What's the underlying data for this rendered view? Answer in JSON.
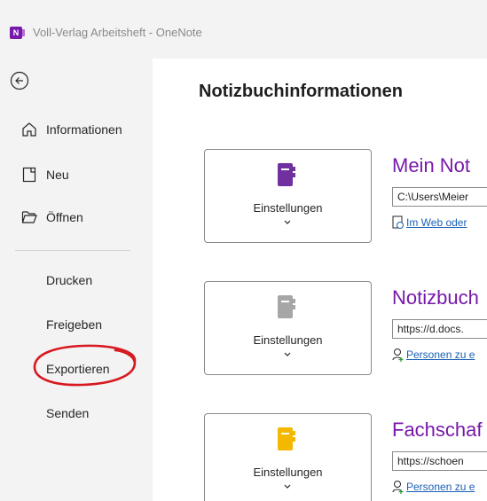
{
  "window": {
    "title": "Voll-Verlag Arbeitsheft - OneNote",
    "app_badge": "N"
  },
  "sidebar": {
    "back_label": "Zurück",
    "items": [
      {
        "label": "Informationen",
        "icon": "home-icon"
      },
      {
        "label": "Neu",
        "icon": "new-page-icon"
      },
      {
        "label": "Öffnen",
        "icon": "folder-open-icon"
      }
    ],
    "plain_items": [
      "Drucken",
      "Freigeben",
      "Exportieren",
      "Senden"
    ]
  },
  "main": {
    "title": "Notizbuchinformationen",
    "notebooks": [
      {
        "name": "Mein Not",
        "color": "#7030a0",
        "path": "C:\\Users\\Meier",
        "link_text": "Im Web oder",
        "link_icon": "web-share-icon",
        "settings_label": "Einstellungen"
      },
      {
        "name": "Notizbuch",
        "color": "#a6a6a6",
        "path": "https://d.docs.",
        "link_text": "Personen zu e",
        "link_icon": "add-person-icon",
        "settings_label": "Einstellungen"
      },
      {
        "name": "Fachschaf",
        "color": "#f5b800",
        "path": "https://schoen",
        "link_text": "Personen zu e",
        "link_icon": "add-person-icon",
        "settings_label": "Einstellungen"
      }
    ]
  },
  "colors": {
    "accent": "#7719aa",
    "link": "#1a5fb4",
    "annotation": "#d71920"
  }
}
